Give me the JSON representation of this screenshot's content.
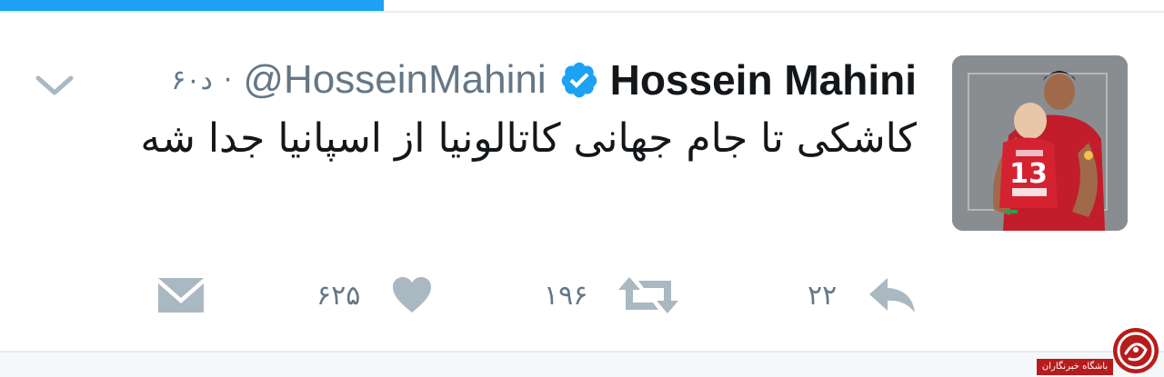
{
  "progress": {
    "fraction": 0.33
  },
  "tweet": {
    "author": {
      "name": "Hossein Mahini",
      "handle": "@HosseinMahini",
      "verified": true,
      "avatar_icon": "profile-photo"
    },
    "separator": "·",
    "time": "۶۰د",
    "text": "کاشکی تا جام جهانی کاتالونیا از اسپانیا جدا شه",
    "actions": {
      "reply": {
        "icon": "reply-icon",
        "count": "۲۲"
      },
      "retweet": {
        "icon": "retweet-icon",
        "count": "۱۹۶"
      },
      "like": {
        "icon": "heart-icon",
        "count": "۶۲۵"
      },
      "message": {
        "icon": "envelope-icon"
      }
    }
  },
  "watermark": {
    "label": "باشگاه خبرنگاران"
  },
  "colors": {
    "accent": "#1da1f2",
    "text_primary": "#14171a",
    "text_secondary": "#657786",
    "icon_gray": "#aab8c2",
    "watermark_red": "#b71c1c"
  }
}
